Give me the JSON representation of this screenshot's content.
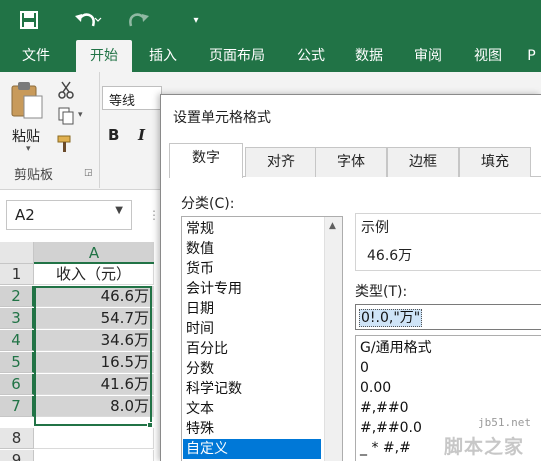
{
  "ribbon_tabs": [
    "文件",
    "开始",
    "插入",
    "页面布局",
    "公式",
    "数据",
    "审阅",
    "视图",
    "P"
  ],
  "ribbon": {
    "paste_label": "粘贴",
    "clipboard_group": "剪贴板",
    "font_name": "等线",
    "bold": "B",
    "italic": "I"
  },
  "name_box": "A2",
  "sheet": {
    "column_header": "A",
    "row_numbers": [
      "1",
      "2",
      "3",
      "4",
      "5",
      "6",
      "7",
      "8",
      "9"
    ],
    "cells": [
      "收入（元）",
      "46.6万",
      "54.7万",
      "34.6万",
      "16.5万",
      "41.6万",
      "8.0万",
      "",
      ""
    ]
  },
  "dialog": {
    "title": "设置单元格格式",
    "tabs": [
      "数字",
      "对齐",
      "字体",
      "边框",
      "填充"
    ],
    "category_label": "分类(C):",
    "categories": [
      "常规",
      "数值",
      "货币",
      "会计专用",
      "日期",
      "时间",
      "百分比",
      "分数",
      "科学记数",
      "文本",
      "特殊",
      "自定义"
    ],
    "selected_category": "自定义",
    "sample_label": "示例",
    "sample_value": "46.6万",
    "type_label": "类型(T):",
    "type_value": "0!.0,\"万\"",
    "type_list": [
      "G/通用格式",
      "0",
      "0.00",
      "#,##0",
      "#,##0.0",
      "_ * #,#"
    ]
  },
  "watermark": {
    "url": "jb51.net",
    "text": "脚本之家"
  },
  "colors": {
    "excel_green": "#217346",
    "selection_blue": "#0078d7"
  }
}
